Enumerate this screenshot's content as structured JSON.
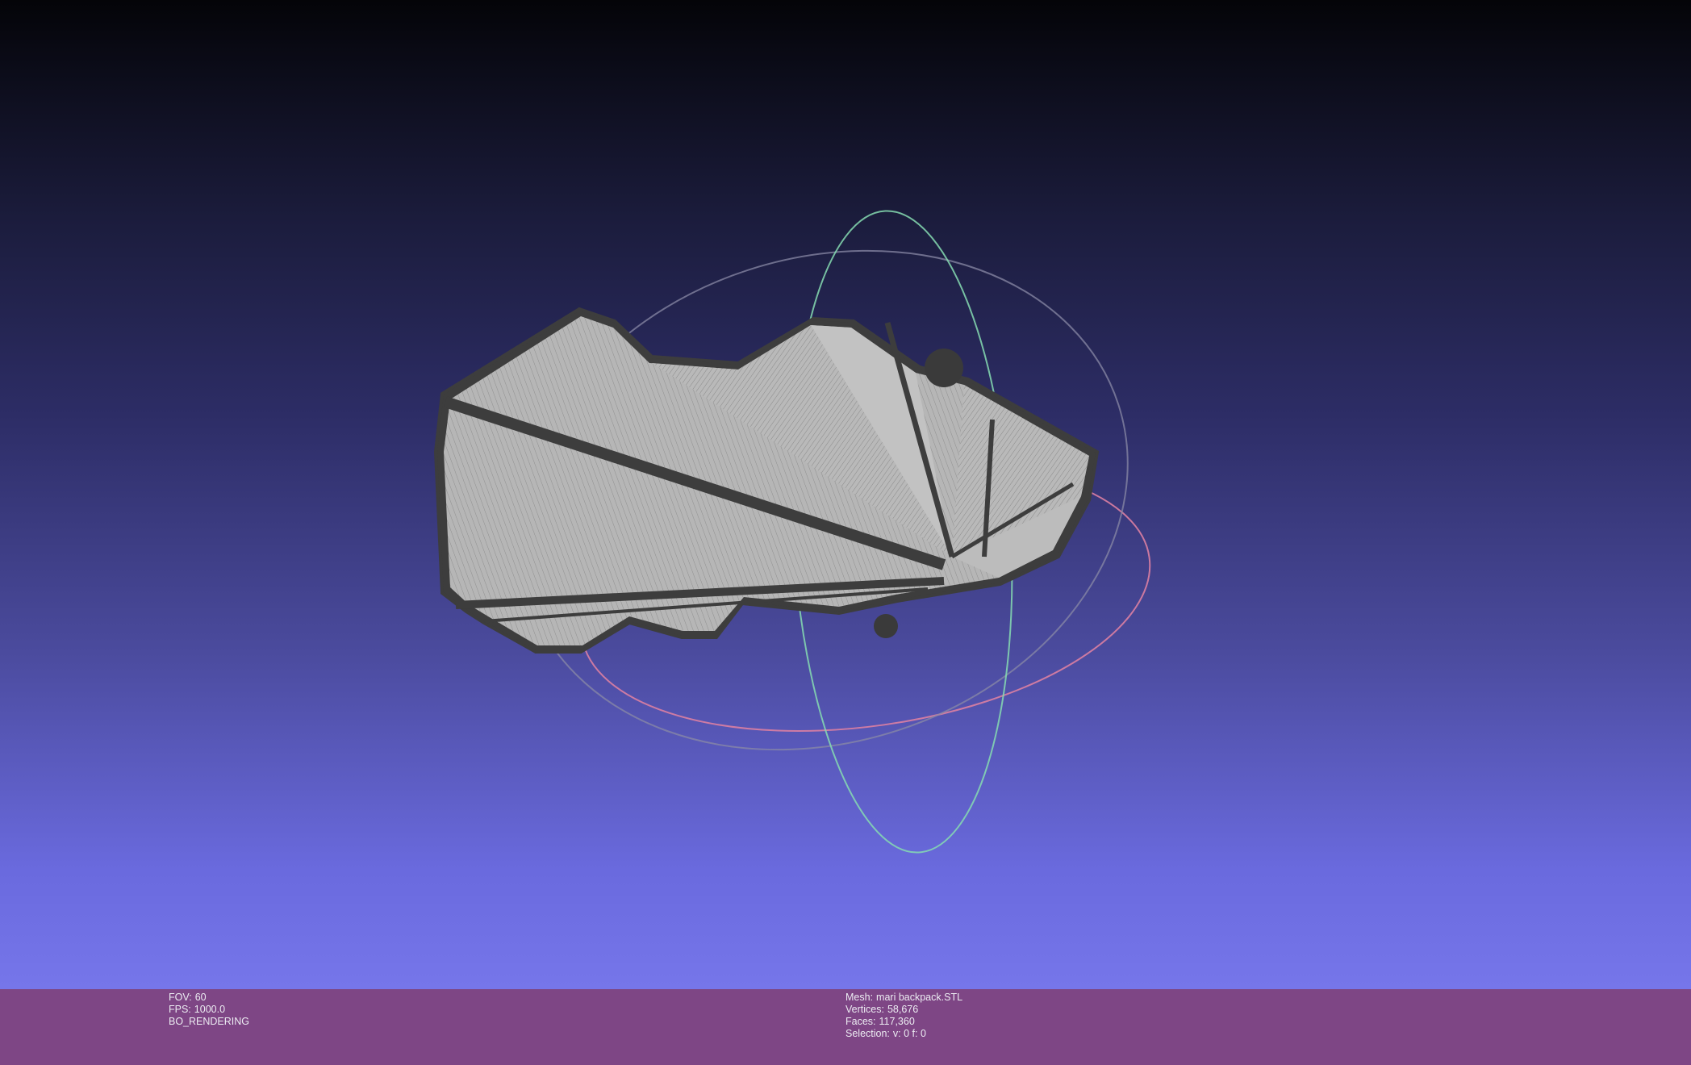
{
  "viewport": {
    "background_top": "#040408",
    "background_bottom": "#7676ea",
    "mesh_fill": "#b3b3b3",
    "mesh_edge": "#444444",
    "trackball_colors": [
      "#e07aa0",
      "#7fe0b0",
      "#a09ae6"
    ]
  },
  "status_left": {
    "fov_label": "FOV:",
    "fov_value": "60",
    "fps_label": "FPS:",
    "fps_value": "1000.0",
    "render_mode": "BO_RENDERING"
  },
  "status_right": {
    "mesh_label": "Mesh:",
    "mesh_name": "mari backpack.STL",
    "vertices_label": "Vertices:",
    "vertices_value": "58,676",
    "faces_label": "Faces:",
    "faces_value": "117,360",
    "selection_label": "Selection:",
    "selection_value": "v: 0 f: 0"
  }
}
